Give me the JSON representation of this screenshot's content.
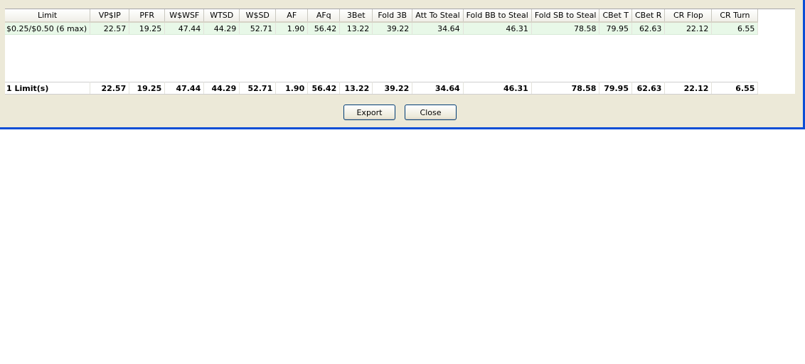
{
  "table": {
    "columns": [
      "Limit",
      "VP$IP",
      "PFR",
      "W$WSF",
      "WTSD",
      "W$SD",
      "AF",
      "AFq",
      "3Bet",
      "Fold 3B",
      "Att To Steal",
      "Fold BB to Steal",
      "Fold SB to Steal",
      "CBet T",
      "CBet R",
      "CR Flop",
      "CR Turn"
    ],
    "rows": [
      [
        "$0.25/$0.50 (6 max)",
        "22.57",
        "19.25",
        "47.44",
        "44.29",
        "52.71",
        "1.90",
        "56.42",
        "13.22",
        "39.22",
        "34.64",
        "46.31",
        "78.58",
        "79.95",
        "62.63",
        "22.12",
        "6.55"
      ]
    ],
    "totals": [
      "1 Limit(s)",
      "22.57",
      "19.25",
      "47.44",
      "44.29",
      "52.71",
      "1.90",
      "56.42",
      "13.22",
      "39.22",
      "34.64",
      "46.31",
      "78.58",
      "79.95",
      "62.63",
      "22.12",
      "6.55"
    ]
  },
  "buttons": {
    "export": "Export",
    "close": "Close"
  },
  "colors": {
    "window_bg": "#ece9d8",
    "row_highlight": "#e8f8e8",
    "frame_blue": "#0a4ed6"
  }
}
